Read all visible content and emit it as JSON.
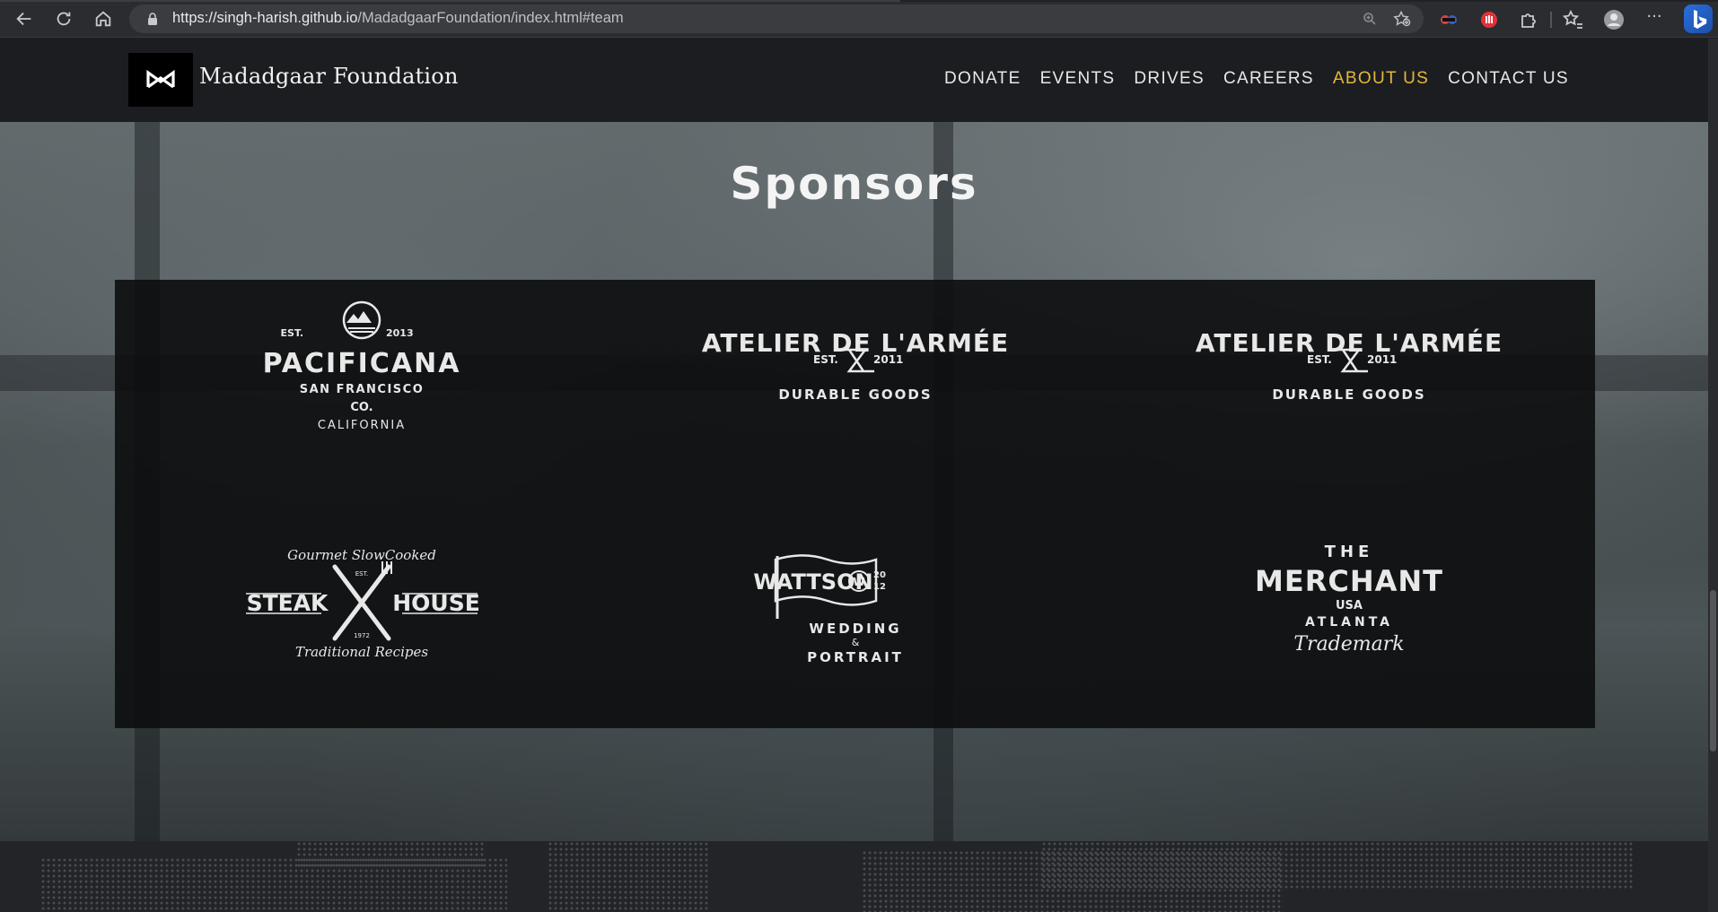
{
  "browser": {
    "url_host": "https://singh-harish.github.io",
    "url_path": "/MadadgaarFoundation/index.html#team",
    "icons": [
      "back-icon",
      "reload-icon",
      "home-icon",
      "lock-icon",
      "zoom-icon",
      "add-favorite-icon",
      "extension-icon",
      "favorites-icon",
      "profile-icon",
      "more-icon",
      "bing-icon"
    ]
  },
  "header": {
    "brand": "Madadgaar Foundation",
    "nav": [
      {
        "label": "DONATE",
        "active": false
      },
      {
        "label": "EVENTS",
        "active": false
      },
      {
        "label": "DRIVES",
        "active": false
      },
      {
        "label": "CAREERS",
        "active": false
      },
      {
        "label": "ABOUT US",
        "active": true
      },
      {
        "label": "CONTACT US",
        "active": false
      }
    ],
    "active_color": "#e3b93a"
  },
  "sponsors": {
    "title": "Sponsors",
    "logos": [
      {
        "name": "pacificana",
        "est": "EST.",
        "year": "2013",
        "main": "PACIFICANA",
        "line2": "SAN FRANCISCO",
        "line3": "CO.",
        "arc": "CALIFORNIA"
      },
      {
        "name": "atelier-1",
        "top": "ATELIER DE L'ARMÉE",
        "est": "EST.",
        "year": "2011",
        "arc": "DURABLE GOODS"
      },
      {
        "name": "atelier-2",
        "top": "ATELIER DE L'ARMÉE",
        "est": "EST.",
        "year": "2011",
        "arc": "DURABLE GOODS"
      },
      {
        "name": "steak-house",
        "top": "Gourmet SlowCooked",
        "left": "STEAK",
        "right": "HOUSE",
        "est": "EST.",
        "year": "1972",
        "bottom": "Traditional Recipes"
      },
      {
        "name": "wattson",
        "main": "WATTSON",
        "mono": "W",
        "year_top": "20",
        "year_bottom": "12",
        "line2": "WEDDING",
        "amp": "&",
        "arc": "PORTRAIT"
      },
      {
        "name": "merchant",
        "top": "THE",
        "main": "MERCHANT",
        "line2": "USA",
        "arc": "ATLANTA",
        "script": "Trademark"
      }
    ]
  }
}
